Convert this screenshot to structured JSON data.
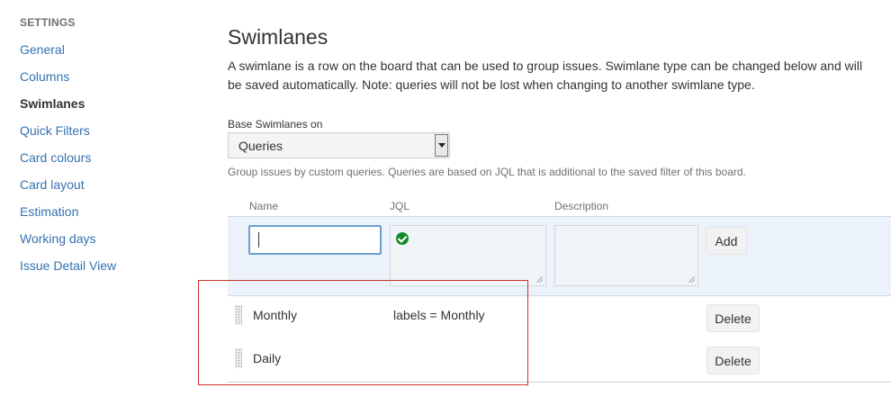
{
  "sidebar": {
    "heading": "SETTINGS",
    "items": [
      {
        "label": "General",
        "active": false
      },
      {
        "label": "Columns",
        "active": false
      },
      {
        "label": "Swimlanes",
        "active": true
      },
      {
        "label": "Quick Filters",
        "active": false
      },
      {
        "label": "Card colours",
        "active": false
      },
      {
        "label": "Card layout",
        "active": false
      },
      {
        "label": "Estimation",
        "active": false
      },
      {
        "label": "Working days",
        "active": false
      },
      {
        "label": "Issue Detail View",
        "active": false
      }
    ]
  },
  "main": {
    "title": "Swimlanes",
    "description": "A swimlane is a row on the board that can be used to group issues. Swimlane type can be changed below and will be saved automatically. Note: queries will not be lost when changing to another swimlane type.",
    "base_label": "Base Swimlanes on",
    "base_value": "Queries",
    "help": "Group issues by custom queries. Queries are based on JQL that is additional to the saved filter of this board.",
    "columns": {
      "name": "Name",
      "jql": "JQL",
      "description": "Description"
    },
    "add_row": {
      "name_value": "",
      "jql_value": "",
      "description_value": "",
      "jql_status": "check-valid-icon",
      "add_label": "Add"
    },
    "swimlanes": [
      {
        "name": "Monthly",
        "jql": "labels = Monthly",
        "delete_label": "Delete"
      },
      {
        "name": "Daily",
        "jql": "",
        "delete_label": "Delete"
      }
    ]
  },
  "colors": {
    "link": "#3572b0",
    "add_row_bg": "#ebf2f9",
    "valid": "#14892c",
    "highlight": "#c9302c"
  }
}
